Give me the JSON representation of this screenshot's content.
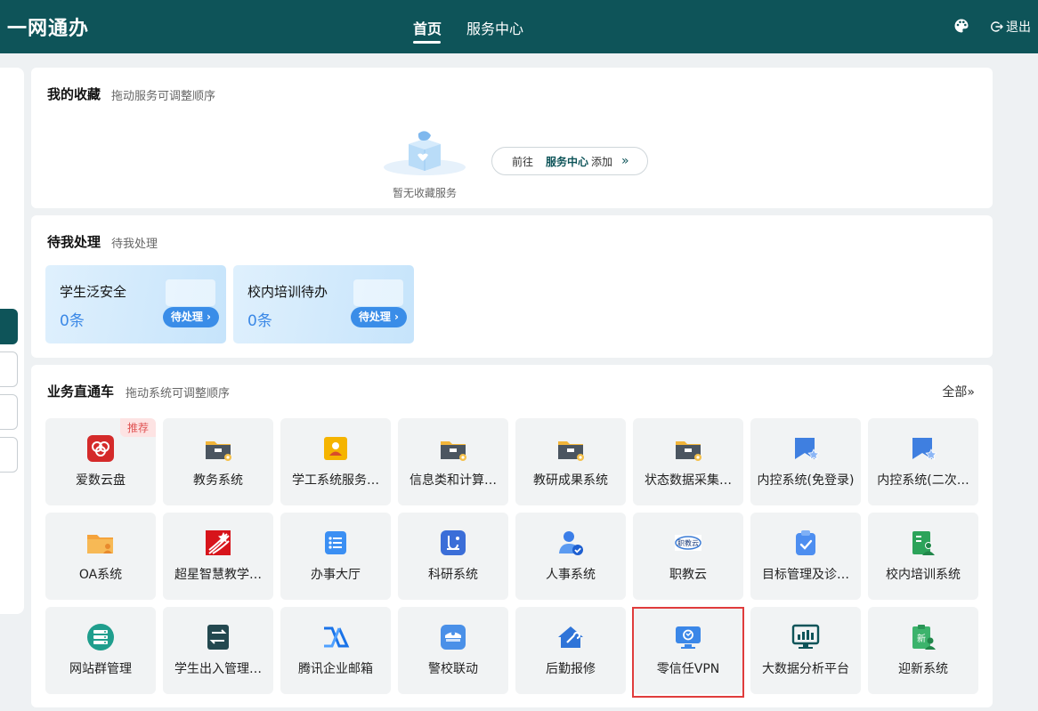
{
  "header": {
    "brand": "一网通办",
    "tabs": [
      {
        "label": "首页",
        "active": true
      },
      {
        "label": "服务中心",
        "active": false
      }
    ],
    "theme_icon": "palette-icon",
    "logout_label": "退出",
    "colors": {
      "bar": "#0e5459",
      "accent_blue": "#3a88e6",
      "highlight": "#e03c3c"
    }
  },
  "favorites": {
    "title": "我的收藏",
    "subtitle": "拖动服务可调整顺序",
    "empty_text": "暂无收藏服务",
    "goto": {
      "prefix": "前往",
      "service": "服务中心",
      "suffix": "添加"
    }
  },
  "pending": {
    "title": "待我处理",
    "subtitle": "待我处理",
    "items": [
      {
        "title": "学生泛安全",
        "count": "0条",
        "action": "待处理"
      },
      {
        "title": "校内培训待办",
        "count": "0条",
        "action": "待处理"
      }
    ]
  },
  "business": {
    "title": "业务直通车",
    "subtitle": "拖动系统可调整顺序",
    "all_label": "全部",
    "tiles": [
      {
        "label": "爱数云盘",
        "icon": "cloud-disk-icon",
        "badge": "推荐"
      },
      {
        "label": "教务系统",
        "icon": "folder-gear-icon"
      },
      {
        "label": "学工系统服务…",
        "icon": "user-card-icon"
      },
      {
        "label": "信息类和计算…",
        "icon": "folder-gear-icon"
      },
      {
        "label": "教研成果系统",
        "icon": "folder-gear-icon"
      },
      {
        "label": "状态数据采集…",
        "icon": "folder-gear-icon"
      },
      {
        "label": "内控系统(免登录)",
        "icon": "bookmark-star-icon"
      },
      {
        "label": "内控系统(二次…",
        "icon": "bookmark-star-icon"
      },
      {
        "label": "OA系统",
        "icon": "folder-user-icon"
      },
      {
        "label": "超星智慧教学…",
        "icon": "chaoxing-logo-icon"
      },
      {
        "label": "办事大厅",
        "icon": "list-icon"
      },
      {
        "label": "科研系统",
        "icon": "research-icon"
      },
      {
        "label": "人事系统",
        "icon": "person-check-icon"
      },
      {
        "label": "职教云",
        "icon": "zhijiaoyun-logo-icon"
      },
      {
        "label": "目标管理及诊…",
        "icon": "clipboard-check-icon"
      },
      {
        "label": "校内培训系统",
        "icon": "doc-user-icon"
      },
      {
        "label": "网站群管理",
        "icon": "server-icon"
      },
      {
        "label": "学生出入管理…",
        "icon": "transfer-icon"
      },
      {
        "label": "腾讯企业邮箱",
        "icon": "tencent-mail-icon"
      },
      {
        "label": "警校联动",
        "icon": "police-cap-icon"
      },
      {
        "label": "后勤报修",
        "icon": "house-wrench-icon"
      },
      {
        "label": "零信任VPN",
        "icon": "monitor-shield-icon",
        "highlighted": true
      },
      {
        "label": "大数据分析平台",
        "icon": "monitor-chart-icon"
      },
      {
        "label": "迎新系统",
        "icon": "welcome-icon"
      }
    ]
  }
}
